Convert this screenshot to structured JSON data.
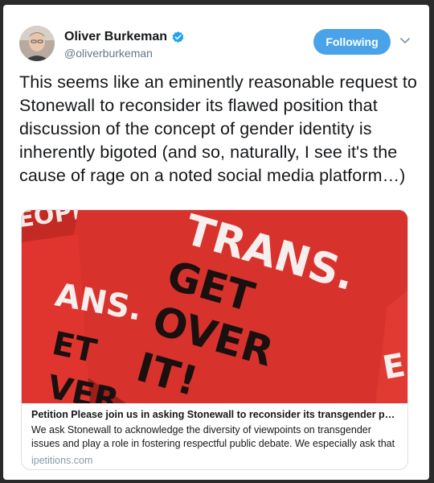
{
  "author": {
    "name": "Oliver Burkeman",
    "handle": "@oliverburkeman",
    "verified": true,
    "avatar": "avatar-photo"
  },
  "follow_button": {
    "label": "Following",
    "color": "#4aa3e8"
  },
  "menu_icon": "chevron-down-icon",
  "tweet": {
    "text": "This seems like an eminently reasonable request to Stonewall to reconsider its flawed position that discussion of the concept of gender identity is inherently bigoted (and so, naturally, I see it's the cause of rage on a noted social media platform…)"
  },
  "link_card": {
    "image": {
      "description_icon": "trans-get-over-it-image",
      "background_color": "#d8322c",
      "texts": [
        "TRANS.",
        "GET",
        "OVER",
        "IT!",
        "ANS.",
        "ET",
        "VER",
        "EOPLE",
        "E"
      ]
    },
    "title": "Petition Please join us in asking Stonewall to reconsider its transgender poli…",
    "description": "We ask Stonewall to acknowledge the diversity of viewpoints on transgender issues and play a role in fostering respectful public debate. We especially ask that Stonew…",
    "domain": "ipetitions.com"
  }
}
